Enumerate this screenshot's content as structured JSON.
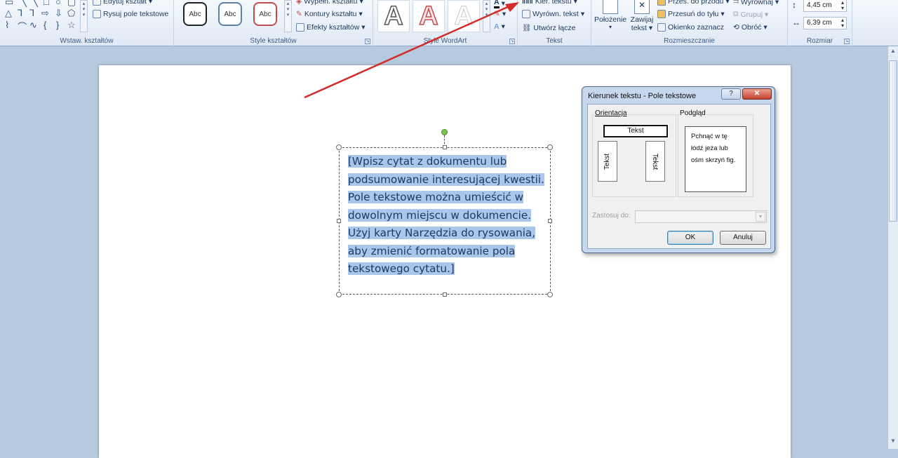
{
  "ribbon": {
    "groups": {
      "insert_shapes": "Wstaw. kształtów",
      "shape_styles": "Style kształtów",
      "wordart_styles": "Style WordArt",
      "text": "Tekst",
      "arrange": "Rozmieszczanie",
      "size": "Rozmiar"
    },
    "insert_shapes": {
      "edit_shape": "Edytuj kształt",
      "draw_text_box": "Rysuj pole tekstowe"
    },
    "shape_styles": {
      "presets": [
        "Abc",
        "Abc",
        "Abc"
      ],
      "shape_fill": "Wypełn. kształtu",
      "shape_outline": "Kontury kształtu",
      "shape_effects": "Efekty kształtów"
    },
    "wordart": {
      "presets": [
        "A",
        "A",
        "A"
      ]
    },
    "text": {
      "text_direction": "Kier. tekstu",
      "align_text": "Wyrówn. tekst",
      "create_link": "Utwórz łącze"
    },
    "arrange": {
      "position": "Położenie",
      "wrap_text_line1": "Zawijaj",
      "wrap_text_line2": "tekst",
      "bring_forward": "Przes. do przodu",
      "send_backward": "Przesuń do tyłu",
      "selection_pane": "Okienko zaznacz",
      "align": "Wyrównaj",
      "group": "Grupuj",
      "rotate": "Obróć"
    },
    "size": {
      "height": "4,45 cm",
      "width": "6,39 cm"
    }
  },
  "textbox": {
    "content": "[Wpisz cytat z dokumentu lub podsumowanie interesującej kwestii. Pole tekstowe można umieścić w dowolnym miejscu w dokumencie. Użyj karty Narzędzia do rysowania, aby zmienić formatowanie pola tekstowego cytatu.]"
  },
  "dialog": {
    "title": "Kierunek tekstu - Pole tekstowe",
    "help": "?",
    "close": "✕",
    "orientation_label": "Orientacja",
    "orientation_horizontal": "Tekst",
    "orientation_vertical_down": "Tekst",
    "orientation_vertical_up": "Tekst",
    "preview_label": "Podgląd",
    "preview_line1": "Pchnąć w tę",
    "preview_line2": "łódź jeża lub",
    "preview_line3": "ośm skrzyń fig.",
    "apply_to_label": "Zastosuj do:",
    "ok": "OK",
    "cancel": "Anuluj"
  },
  "colors": {
    "accent_red_arrow": "#d32a2a",
    "selection_highlight": "#a9c7ea",
    "rotation_handle": "#7dc24b"
  }
}
